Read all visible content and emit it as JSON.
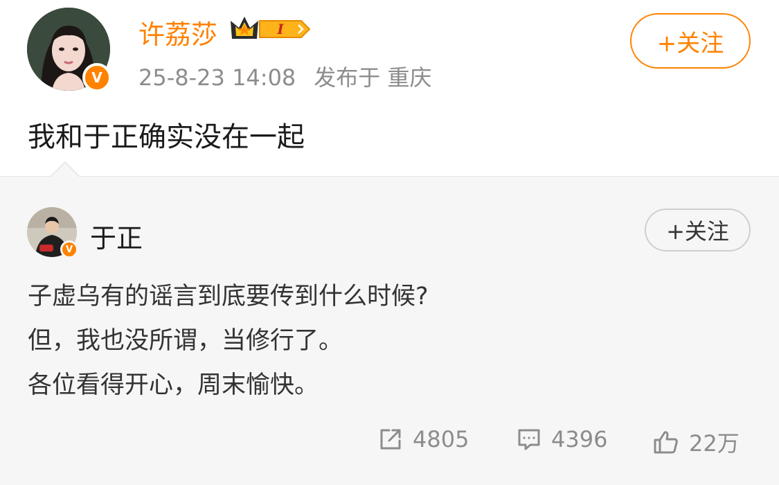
{
  "post": {
    "author": "许荔莎",
    "date": "25-8-23 14:08",
    "location": "发布于 重庆",
    "follow_label": "+关注",
    "text": "我和于正确实没在一起"
  },
  "repost": {
    "author": "于正",
    "follow_label": "+关注",
    "lines": [
      "子虚乌有的谣言到底要传到什么时候?",
      "但，我也没所谓，当修行了。",
      "各位看得开心，周末愉快。"
    ],
    "actions": {
      "shares": "4805",
      "comments": "4396",
      "likes": "22万"
    }
  },
  "colors": {
    "accent": "#ff8200",
    "muted": "#8c8c8c",
    "repost_bg": "#f6f6f6"
  }
}
